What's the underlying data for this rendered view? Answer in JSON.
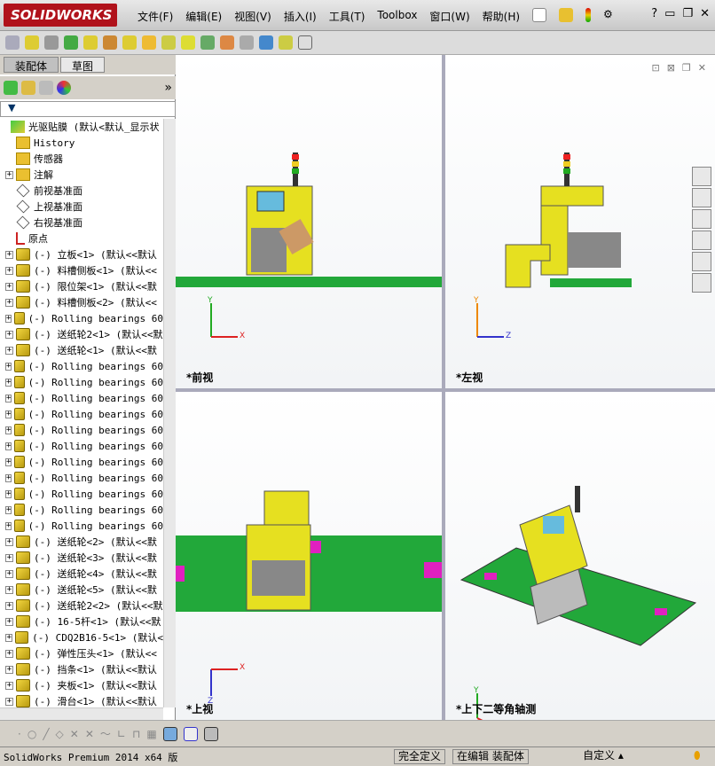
{
  "app": {
    "logo": "SOLIDWORKS"
  },
  "menu": [
    "文件(F)",
    "编辑(E)",
    "视图(V)",
    "插入(I)",
    "工具(T)",
    "Toolbox",
    "窗口(W)",
    "帮助(H)"
  ],
  "tabs": [
    "装配体",
    "草图"
  ],
  "tree": [
    {
      "label": "光驱贴膜  (默认<默认_显示状",
      "type": "asm",
      "expand": false,
      "indent": 0
    },
    {
      "label": "History",
      "type": "history",
      "expand": false,
      "indent": 1
    },
    {
      "label": "传感器",
      "type": "sensor",
      "expand": false,
      "indent": 1
    },
    {
      "label": "注解",
      "type": "annot",
      "expand": true,
      "indent": 1
    },
    {
      "label": "前视基准面",
      "type": "plane",
      "expand": false,
      "indent": 1
    },
    {
      "label": "上视基准面",
      "type": "plane",
      "expand": false,
      "indent": 1
    },
    {
      "label": "右视基准面",
      "type": "plane",
      "expand": false,
      "indent": 1
    },
    {
      "label": "原点",
      "type": "origin",
      "expand": false,
      "indent": 1
    },
    {
      "label": "(-) 立板<1> (默认<<默认",
      "type": "part",
      "expand": true,
      "indent": 1
    },
    {
      "label": "(-) 料槽侧板<1> (默认<<",
      "type": "part",
      "expand": true,
      "indent": 1
    },
    {
      "label": "(-) 限位架<1> (默认<<默",
      "type": "part",
      "expand": true,
      "indent": 1
    },
    {
      "label": "(-) 料槽侧板<2> (默认<<",
      "type": "part",
      "expand": true,
      "indent": 1
    },
    {
      "label": "(-) Rolling bearings 60",
      "type": "part",
      "expand": true,
      "indent": 1
    },
    {
      "label": "(-) 送纸轮2<1> (默认<<默",
      "type": "part",
      "expand": true,
      "indent": 1
    },
    {
      "label": "(-) 送纸轮<1> (默认<<默",
      "type": "part",
      "expand": true,
      "indent": 1
    },
    {
      "label": "(-) Rolling bearings 60",
      "type": "part",
      "expand": true,
      "indent": 1
    },
    {
      "label": "(-) Rolling bearings 60",
      "type": "part",
      "expand": true,
      "indent": 1
    },
    {
      "label": "(-) Rolling bearings 60",
      "type": "part",
      "expand": true,
      "indent": 1
    },
    {
      "label": "(-) Rolling bearings 60",
      "type": "part",
      "expand": true,
      "indent": 1
    },
    {
      "label": "(-) Rolling bearings 60",
      "type": "part",
      "expand": true,
      "indent": 1
    },
    {
      "label": "(-) Rolling bearings 60",
      "type": "part",
      "expand": true,
      "indent": 1
    },
    {
      "label": "(-) Rolling bearings 60",
      "type": "part",
      "expand": true,
      "indent": 1
    },
    {
      "label": "(-) Rolling bearings 60",
      "type": "part",
      "expand": true,
      "indent": 1
    },
    {
      "label": "(-) Rolling bearings 60",
      "type": "part",
      "expand": true,
      "indent": 1
    },
    {
      "label": "(-) Rolling bearings 60",
      "type": "part",
      "expand": true,
      "indent": 1
    },
    {
      "label": "(-) Rolling bearings 60",
      "type": "part",
      "expand": true,
      "indent": 1
    },
    {
      "label": "(-) 送纸轮<2> (默认<<默",
      "type": "part",
      "expand": true,
      "indent": 1
    },
    {
      "label": "(-) 送纸轮<3> (默认<<默",
      "type": "part",
      "expand": true,
      "indent": 1
    },
    {
      "label": "(-) 送纸轮<4> (默认<<默",
      "type": "part",
      "expand": true,
      "indent": 1
    },
    {
      "label": "(-) 送纸轮<5> (默认<<默",
      "type": "part",
      "expand": true,
      "indent": 1
    },
    {
      "label": "(-) 送纸轮2<2> (默认<<默",
      "type": "part",
      "expand": true,
      "indent": 1
    },
    {
      "label": "(-) 16-5杆<1> (默认<<默",
      "type": "part",
      "expand": true,
      "indent": 1
    },
    {
      "label": "(-) CDQ2B16-5<1> (默认<",
      "type": "part",
      "expand": true,
      "indent": 1
    },
    {
      "label": "(-) 弹性压头<1> (默认<<",
      "type": "part",
      "expand": true,
      "indent": 1
    },
    {
      "label": "(-) 挡条<1> (默认<<默认",
      "type": "part",
      "expand": true,
      "indent": 1
    },
    {
      "label": "(-) 夹板<1> (默认<<默认",
      "type": "part",
      "expand": true,
      "indent": 1
    },
    {
      "label": "(-) 滑台<1> (默认<<默认",
      "type": "part",
      "expand": true,
      "indent": 1
    }
  ],
  "viewports": {
    "front": "*前视",
    "left": "*左视",
    "top": "*上视",
    "iso": "*上下二等角轴测"
  },
  "axes": {
    "x": "X",
    "y": "Y",
    "z": "Z"
  },
  "status": {
    "product": "SolidWorks Premium 2014 x64 版",
    "defined": "完全定义",
    "editing": "在编辑 装配体",
    "units": "自定义"
  },
  "colors": {
    "brand": "#b0121b",
    "base": "#22a83a",
    "body": "#e6e020",
    "accent": "#e020c0"
  }
}
